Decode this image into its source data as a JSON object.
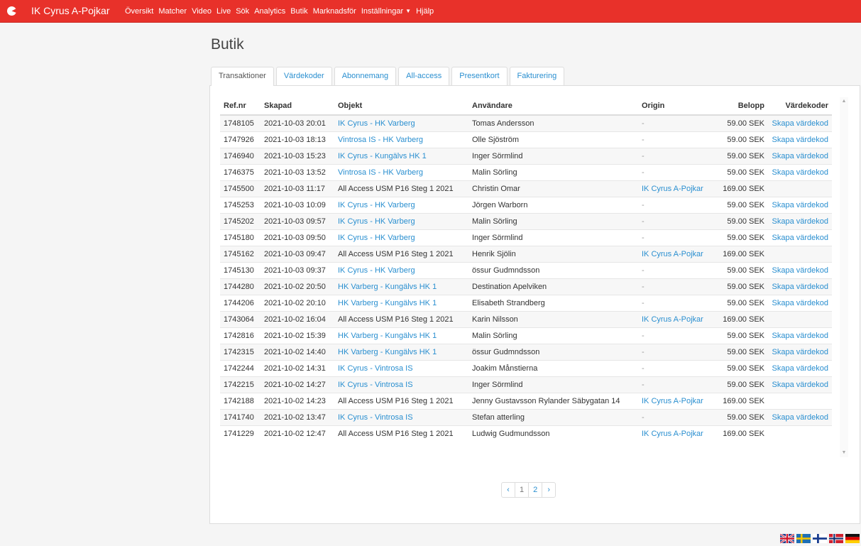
{
  "navbar": {
    "brand": "IK Cyrus A-Pojkar",
    "links": [
      "Översikt",
      "Matcher",
      "Video",
      "Live",
      "Sök",
      "Analytics",
      "Butik",
      "Marknadsför",
      "Inställningar",
      "Hjälp"
    ],
    "brand_color": "#e8312a"
  },
  "page": {
    "title": "Butik"
  },
  "tabs": [
    "Transaktioner",
    "Värdekoder",
    "Abonnemang",
    "All-access",
    "Presentkort",
    "Fakturering"
  ],
  "table": {
    "headers": [
      "Ref.nr",
      "Skapad",
      "Objekt",
      "Användare",
      "Origin",
      "Belopp",
      "Värdekoder"
    ],
    "rows": [
      [
        "1748105",
        "2021-10-03 20:01",
        "IK Cyrus - HK Varberg",
        "Tomas Andersson",
        "-",
        "59.00 SEK",
        "Skapa värdekod"
      ],
      [
        "1747926",
        "2021-10-03 18:13",
        "Vintrosa IS - HK Varberg",
        "Olle Sjöström",
        "-",
        "59.00 SEK",
        "Skapa värdekod"
      ],
      [
        "1746940",
        "2021-10-03 15:23",
        "IK Cyrus - Kungälvs HK 1",
        "Inger Sörmlind",
        "-",
        "59.00 SEK",
        "Skapa värdekod"
      ],
      [
        "1746375",
        "2021-10-03 13:52",
        "Vintrosa IS - HK Varberg",
        "Malin Sörling",
        "-",
        "59.00 SEK",
        "Skapa värdekod"
      ],
      [
        "1745500",
        "2021-10-03 11:17",
        "All Access USM P16 Steg 1 2021",
        "Christin Omar",
        "IK Cyrus A-Pojkar",
        "169.00 SEK",
        ""
      ],
      [
        "1745253",
        "2021-10-03 10:09",
        "IK Cyrus - HK Varberg",
        "Jörgen Warborn",
        "-",
        "59.00 SEK",
        "Skapa värdekod"
      ],
      [
        "1745202",
        "2021-10-03 09:57",
        "IK Cyrus - HK Varberg",
        "Malin Sörling",
        "-",
        "59.00 SEK",
        "Skapa värdekod"
      ],
      [
        "1745180",
        "2021-10-03 09:50",
        "IK Cyrus - HK Varberg",
        "Inger Sörmlind",
        "-",
        "59.00 SEK",
        "Skapa värdekod"
      ],
      [
        "1745162",
        "2021-10-03 09:47",
        "All Access USM P16 Steg 1 2021",
        "Henrik Sjölin",
        "IK Cyrus A-Pojkar",
        "169.00 SEK",
        ""
      ],
      [
        "1745130",
        "2021-10-03 09:37",
        "IK Cyrus - HK Varberg",
        "össur Gudmndsson",
        "-",
        "59.00 SEK",
        "Skapa värdekod"
      ],
      [
        "1744280",
        "2021-10-02 20:50",
        "HK Varberg - Kungälvs HK 1",
        "Destination Apelviken",
        "-",
        "59.00 SEK",
        "Skapa värdekod"
      ],
      [
        "1744206",
        "2021-10-02 20:10",
        "HK Varberg - Kungälvs HK 1",
        "Elisabeth Strandberg",
        "-",
        "59.00 SEK",
        "Skapa värdekod"
      ],
      [
        "1743064",
        "2021-10-02 16:04",
        "All Access USM P16 Steg 1 2021",
        "Karin Nilsson",
        "IK Cyrus A-Pojkar",
        "169.00 SEK",
        ""
      ],
      [
        "1742816",
        "2021-10-02 15:39",
        "HK Varberg - Kungälvs HK 1",
        "Malin Sörling",
        "-",
        "59.00 SEK",
        "Skapa värdekod"
      ],
      [
        "1742315",
        "2021-10-02 14:40",
        "HK Varberg - Kungälvs HK 1",
        "össur Gudmndsson",
        "-",
        "59.00 SEK",
        "Skapa värdekod"
      ],
      [
        "1742244",
        "2021-10-02 14:31",
        "IK Cyrus - Vintrosa IS",
        "Joakim Månstierna",
        "-",
        "59.00 SEK",
        "Skapa värdekod"
      ],
      [
        "1742215",
        "2021-10-02 14:27",
        "IK Cyrus - Vintrosa IS",
        "Inger Sörmlind",
        "-",
        "59.00 SEK",
        "Skapa värdekod"
      ],
      [
        "1742188",
        "2021-10-02 14:23",
        "All Access USM P16 Steg 1 2021",
        "Jenny Gustavsson Rylander Säbygatan 14",
        "IK Cyrus A-Pojkar",
        "169.00 SEK",
        ""
      ],
      [
        "1741740",
        "2021-10-02 13:47",
        "IK Cyrus - Vintrosa IS",
        "Stefan atterling",
        "-",
        "59.00 SEK",
        "Skapa värdekod"
      ],
      [
        "1741229",
        "2021-10-02 12:47",
        "All Access USM P16 Steg 1 2021",
        "Ludwig Gudmundsson",
        "IK Cyrus A-Pojkar",
        "169.00 SEK",
        ""
      ]
    ]
  },
  "pagination": {
    "prev": "‹",
    "pages": [
      "1",
      "2"
    ],
    "next": "›",
    "current": "1"
  },
  "footer": {
    "flags": [
      "uk-flag",
      "sweden-flag",
      "finland-flag",
      "norway-flag",
      "germany-flag"
    ]
  },
  "colors": {
    "link": "#2a8fd0"
  }
}
